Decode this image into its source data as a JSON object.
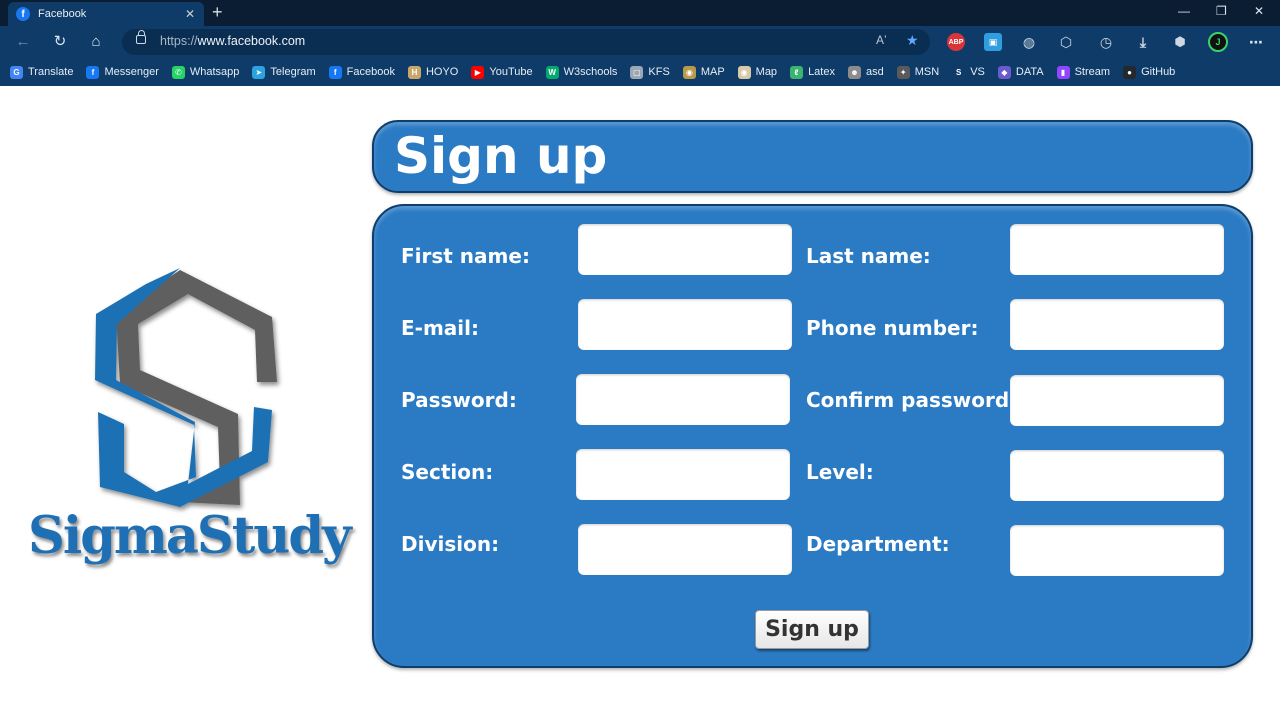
{
  "browser": {
    "tab_title": "Facebook",
    "url_prefix": "https://",
    "url_host": "www.facebook.com",
    "bookmarks": [
      {
        "label": "Translate",
        "icon": "translate-icon",
        "color": "#4285f4"
      },
      {
        "label": "Messenger",
        "icon": "facebook-icon",
        "color": "#1877f2"
      },
      {
        "label": "Whatsapp",
        "icon": "whatsapp-icon",
        "color": "#25d366"
      },
      {
        "label": "Telegram",
        "icon": "telegram-icon",
        "color": "#2aa3df"
      },
      {
        "label": "Facebook",
        "icon": "facebook-icon",
        "color": "#1877f2"
      },
      {
        "label": "HOYO",
        "icon": "hoyo-icon",
        "color": "#c9a66b"
      },
      {
        "label": "YouTube",
        "icon": "youtube-icon",
        "color": "#ff0000"
      },
      {
        "label": "W3schools",
        "icon": "w3schools-icon",
        "color": "#04aa6d"
      },
      {
        "label": "KFS",
        "icon": "document-icon",
        "color": "#9aa8b6"
      },
      {
        "label": "MAP",
        "icon": "map-icon",
        "color": "#b89a4e"
      },
      {
        "label": "Map",
        "icon": "map-icon",
        "color": "#d8c9a8"
      },
      {
        "label": "Latex",
        "icon": "latex-icon",
        "color": "#3cb371"
      },
      {
        "label": "asd",
        "icon": "asd-icon",
        "color": "#8c8c8c"
      },
      {
        "label": "MSN",
        "icon": "msn-icon",
        "color": "#5a5a5a"
      },
      {
        "label": "VS",
        "icon": "vs-icon",
        "color": "#0f3b68"
      },
      {
        "label": "DATA",
        "icon": "data-icon",
        "color": "#6a5acd"
      },
      {
        "label": "Stream",
        "icon": "twitch-icon",
        "color": "#9146ff"
      },
      {
        "label": "GitHub",
        "icon": "github-icon",
        "color": "#24292e"
      }
    ]
  },
  "logo": {
    "brand_text": "SigmaStudy",
    "blue": "#1f6fb4",
    "gray": "#5f5f5f"
  },
  "form": {
    "header_title": "Sign up",
    "panel_color": "#2a7ac4",
    "labels": {
      "first_name": "First name:",
      "last_name": "Last name:",
      "email": "E-mail:",
      "phone": "Phone number:",
      "password": "Password:",
      "confirm_password": "Confirm password:",
      "section": "Section:",
      "level": "Level:",
      "division": "Division:",
      "department": "Department:"
    },
    "submit_label": "Sign up"
  }
}
